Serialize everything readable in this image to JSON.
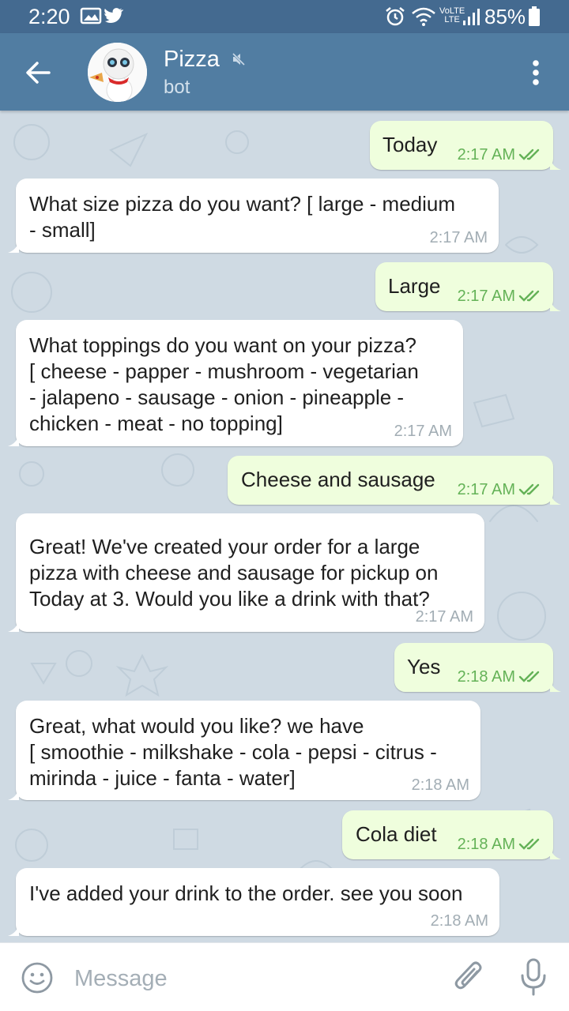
{
  "status_bar": {
    "time": "2:20",
    "battery": "85%",
    "network": "LTE"
  },
  "header": {
    "title": "Pizza",
    "subtitle": "bot"
  },
  "messages": [
    {
      "dir": "out",
      "text": "Today",
      "time": "2:17 AM"
    },
    {
      "dir": "in",
      "text": "What size pizza do you want? [ large - medium\n- small]",
      "time": "2:17 AM"
    },
    {
      "dir": "out",
      "text": "Large",
      "time": "2:17 AM"
    },
    {
      "dir": "in",
      "text": "What toppings do you want on your pizza?\n[ cheese - papper -  mushroom - vegetarian\n- jalapeno - sausage - onion - pineapple -\nchicken - meat -  no topping]",
      "time": "2:17 AM"
    },
    {
      "dir": "out",
      "text": "Cheese and sausage",
      "time": "2:17 AM"
    },
    {
      "dir": "in",
      "text": "Great! We've created your order for a large\npizza with cheese and sausage for pickup on\nToday at 3. Would you like a drink with that?",
      "time": "2:17 AM"
    },
    {
      "dir": "out",
      "text": "Yes",
      "time": "2:18 AM"
    },
    {
      "dir": "in",
      "text": "Great, what would you like? we have\n[ smoothie - milkshake - cola - pepsi - citrus -\nmirinda - juice - fanta - water]",
      "time": "2:18 AM"
    },
    {
      "dir": "out",
      "text": "Cola diet",
      "time": "2:18 AM"
    },
    {
      "dir": "in",
      "text": "I've added your drink to the order. see you soon",
      "time": "2:18 AM"
    }
  ],
  "input": {
    "placeholder": "Message"
  },
  "colors": {
    "header": "#517da2",
    "status_bar": "#446a90",
    "chat_background": "#cfdae3",
    "outgoing_bubble": "#effedd",
    "incoming_bubble": "#ffffff",
    "read_check": "#64b257"
  },
  "icons": [
    "back-arrow-icon",
    "mute-icon",
    "more-vert-icon",
    "emoji-icon",
    "paperclip-icon",
    "microphone-icon",
    "double-check-icon",
    "alarm-icon",
    "wifi-icon",
    "signal-icon",
    "battery-icon",
    "image-icon",
    "twitter-icon"
  ]
}
